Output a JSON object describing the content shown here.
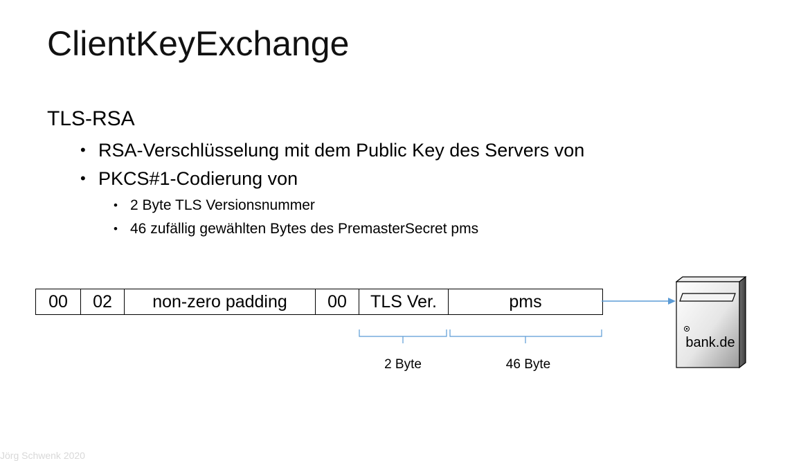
{
  "slide": {
    "title": "ClientKeyExchange",
    "section": "TLS-RSA",
    "bullet_char": "•",
    "bullets": [
      {
        "text": "RSA-Verschlüsselung mit dem Public Key des Servers von"
      },
      {
        "text": "PKCS#1-Codierung von",
        "sub": [
          {
            "text": "2 Byte TLS Versionsnummer"
          },
          {
            "text": "46 zufällig gewählten Bytes des PremasterSecret  pms"
          }
        ]
      }
    ]
  },
  "message": {
    "fields": [
      {
        "label": "00"
      },
      {
        "label": "02"
      },
      {
        "label": "non-zero padding"
      },
      {
        "label": "00"
      },
      {
        "label": "TLS Ver."
      },
      {
        "label": "pms"
      }
    ],
    "size_labels": [
      "2 Byte",
      "46 Byte"
    ]
  },
  "server": {
    "label": "bank.de"
  },
  "footer": "Jörg Schwenk 2020",
  "colors": {
    "arrow": "#5b9bd5",
    "brace": "#5b9bd5",
    "server_gradient_dark": "#8a8a8a"
  }
}
